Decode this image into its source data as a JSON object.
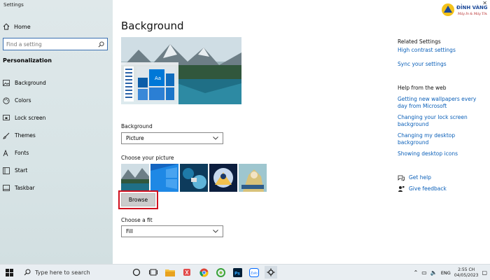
{
  "window": {
    "title": "Settings"
  },
  "sidebar": {
    "home_label": "Home",
    "search_placeholder": "Find a setting",
    "section_label": "Personalization",
    "items": [
      {
        "label": "Background",
        "icon": "picture-icon"
      },
      {
        "label": "Colors",
        "icon": "palette-icon"
      },
      {
        "label": "Lock screen",
        "icon": "lock-screen-icon"
      },
      {
        "label": "Themes",
        "icon": "brush-icon"
      },
      {
        "label": "Fonts",
        "icon": "font-icon"
      },
      {
        "label": "Start",
        "icon": "start-icon"
      },
      {
        "label": "Taskbar",
        "icon": "taskbar-icon"
      }
    ]
  },
  "main": {
    "title": "Background",
    "preview": {
      "sample_text": "Aa"
    },
    "background_label": "Background",
    "background_value": "Picture",
    "choose_picture_label": "Choose your picture",
    "browse_label": "Browse",
    "fit_label": "Choose a fit",
    "fit_value": "Fill"
  },
  "related": {
    "heading": "Related Settings",
    "links": [
      "High contrast settings",
      "Sync your settings"
    ],
    "help_heading": "Help from the web",
    "help_links": [
      "Getting new wallpapers every day from Microsoft",
      "Changing your lock screen background",
      "Changing my desktop background",
      "Showing desktop icons"
    ],
    "get_help": "Get help",
    "give_feedback": "Give feedback"
  },
  "logo": {
    "brand": "ĐỈNH VÀNG",
    "tagline": "Máy In & Máy Tính"
  },
  "taskbar": {
    "search_placeholder": "Type here to search",
    "language": "ENG",
    "time": "2:55 CH",
    "date": "04/05/2023",
    "apps": [
      "task-view-icon",
      "file-explorer-icon",
      "snipping-icon",
      "chrome-icon",
      "green-app-icon",
      "photoshop-icon",
      "zalo-icon",
      "settings-icon"
    ]
  },
  "colors": {
    "accent": "#0078d7",
    "link": "#0a5fb8",
    "highlight": "#d0101e"
  }
}
